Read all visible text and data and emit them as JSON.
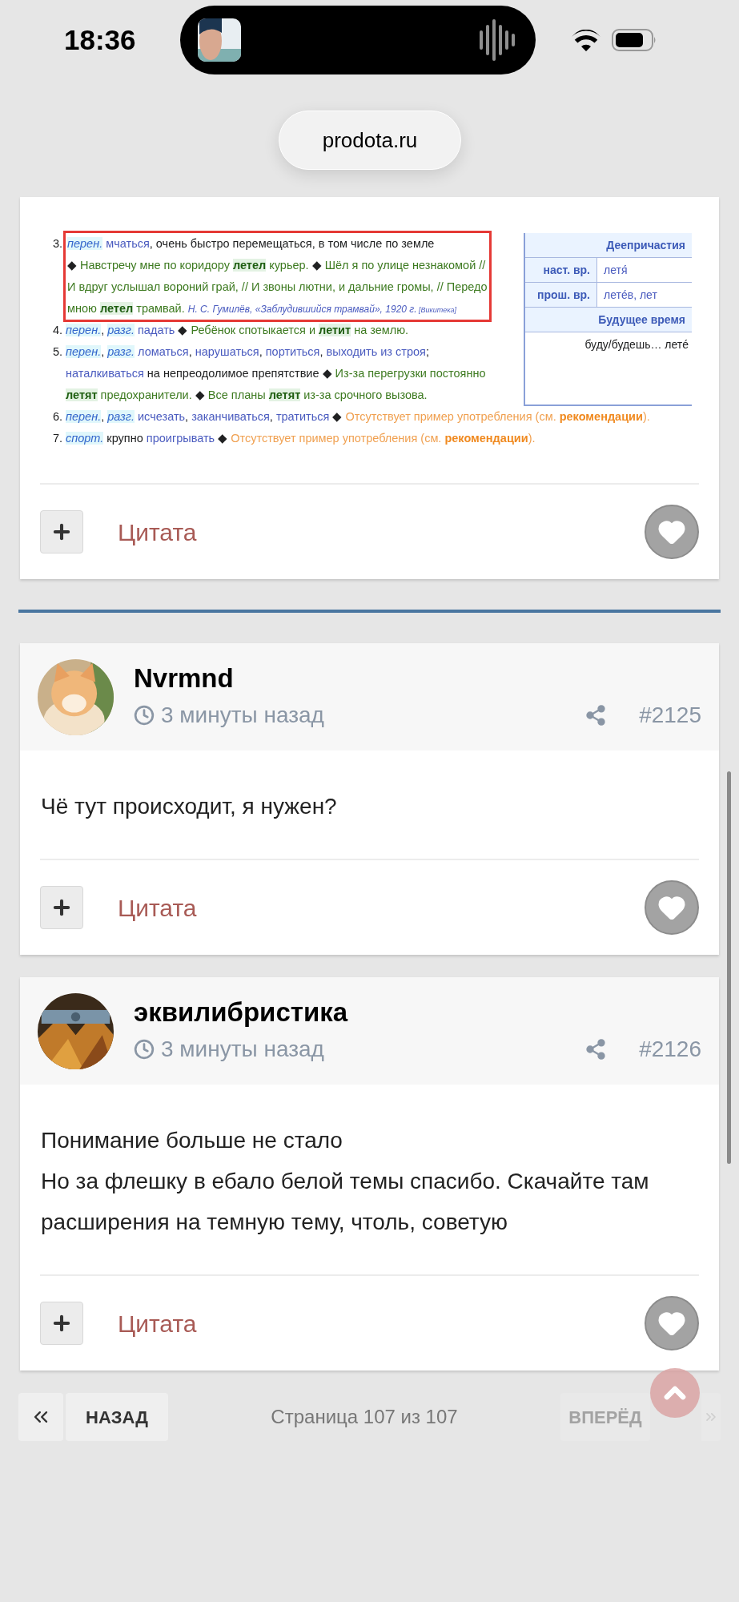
{
  "status_bar": {
    "time": "18:36"
  },
  "address_bar": {
    "url": "prodota.ru"
  },
  "excerpt": {
    "entries": [
      {
        "number": "3.",
        "boxed": true,
        "lines": [
          [
            {
              "kind": "tag",
              "text": "перен."
            },
            {
              "kind": "link",
              "text": " мчаться"
            },
            {
              "kind": "plain",
              "text": ", очень быстро перемещаться, в том числе по земле"
            }
          ],
          [
            {
              "kind": "mark",
              "text": "◆"
            },
            {
              "kind": "ex",
              "text": " Навстречу мне по коридору "
            },
            {
              "kind": "hit",
              "text": "летел"
            },
            {
              "kind": "ex",
              "text": " курьер. "
            },
            {
              "kind": "mark",
              "text": "◆"
            },
            {
              "kind": "ex",
              "text": " Шёл я по улице незнакомой //"
            }
          ],
          [
            {
              "kind": "ex",
              "text": "И вдруг услышал вороний грай, // И звоны лютни, и дальние громы, // Передо"
            }
          ],
          [
            {
              "kind": "ex",
              "text": "мною "
            },
            {
              "kind": "hit",
              "text": "летел"
            },
            {
              "kind": "ex",
              "text": " трамвай. "
            },
            {
              "kind": "src",
              "text": "Н. С. Гумилёв, «Заблудившийся трамвай», 1920 г."
            },
            {
              "kind": "ref",
              "text": " [Викитека]"
            }
          ]
        ]
      },
      {
        "number": "4.",
        "boxed": false,
        "lines": [
          [
            {
              "kind": "tag",
              "text": "перен."
            },
            {
              "kind": "plain",
              "text": ", "
            },
            {
              "kind": "tag",
              "text": "разг."
            },
            {
              "kind": "link",
              "text": " падать"
            },
            {
              "kind": "mark",
              "text": " ◆"
            },
            {
              "kind": "ex",
              "text": " Ребёнок спотыкается и "
            },
            {
              "kind": "hit",
              "text": "летит"
            },
            {
              "kind": "ex",
              "text": " на землю."
            }
          ]
        ]
      },
      {
        "number": "5.",
        "boxed": false,
        "lines": [
          [
            {
              "kind": "tag",
              "text": "перен."
            },
            {
              "kind": "plain",
              "text": ", "
            },
            {
              "kind": "tag",
              "text": "разг."
            },
            {
              "kind": "link",
              "text": " ломаться"
            },
            {
              "kind": "plain",
              "text": ", "
            },
            {
              "kind": "link",
              "text": "нарушаться"
            },
            {
              "kind": "plain",
              "text": ", "
            },
            {
              "kind": "link",
              "text": "портиться"
            },
            {
              "kind": "plain",
              "text": ", "
            },
            {
              "kind": "link",
              "text": "выходить из строя"
            },
            {
              "kind": "plain",
              "text": ";"
            }
          ],
          [
            {
              "kind": "link",
              "text": "наталкиваться"
            },
            {
              "kind": "plain",
              "text": " на непреодолимое препятствие "
            },
            {
              "kind": "mark",
              "text": "◆"
            },
            {
              "kind": "ex",
              "text": " Из-за перегрузки постоянно"
            }
          ],
          [
            {
              "kind": "hit",
              "text": "летят"
            },
            {
              "kind": "ex",
              "text": " предохранители. "
            },
            {
              "kind": "mark",
              "text": "◆"
            },
            {
              "kind": "ex",
              "text": " Все планы "
            },
            {
              "kind": "hit",
              "text": "летят"
            },
            {
              "kind": "ex",
              "text": " из-за срочного вызова."
            }
          ]
        ]
      },
      {
        "number": "6.",
        "boxed": false,
        "lines": [
          [
            {
              "kind": "tag",
              "text": "перен."
            },
            {
              "kind": "plain",
              "text": ", "
            },
            {
              "kind": "tag",
              "text": "разг."
            },
            {
              "kind": "link",
              "text": " исчезать"
            },
            {
              "kind": "plain",
              "text": ", "
            },
            {
              "kind": "link",
              "text": "заканчиваться"
            },
            {
              "kind": "plain",
              "text": ", "
            },
            {
              "kind": "link",
              "text": "тратиться"
            },
            {
              "kind": "mark",
              "text": " ◆"
            },
            {
              "kind": "miss",
              "text": " Отсутствует пример употребления (см. "
            },
            {
              "kind": "missb",
              "text": "рекомендации"
            },
            {
              "kind": "miss",
              "text": ")."
            }
          ]
        ]
      },
      {
        "number": "7.",
        "boxed": false,
        "lines": [
          [
            {
              "kind": "tag",
              "text": "спорт."
            },
            {
              "kind": "plain",
              "text": " крупно "
            },
            {
              "kind": "link",
              "text": "проигрывать"
            },
            {
              "kind": "mark",
              "text": " ◆"
            },
            {
              "kind": "miss",
              "text": " Отсутствует пример употребления (см. "
            },
            {
              "kind": "missb",
              "text": "рекомендации"
            },
            {
              "kind": "miss",
              "text": ")."
            }
          ]
        ]
      }
    ],
    "table": [
      {
        "kind": "header",
        "text": "Деепричастия"
      },
      {
        "kind": "row",
        "label": "наст. вр.",
        "value": "летя́"
      },
      {
        "kind": "row",
        "label": "прош. вр.",
        "value": "летéв, лет"
      },
      {
        "kind": "header",
        "text": "Будущее время"
      },
      {
        "kind": "full",
        "text": "буду/будешь… летé"
      }
    ]
  },
  "first_post_footer": {
    "quote": "Цитата"
  },
  "posts": [
    {
      "author": "Nvrmnd",
      "time": "3 минуты назад",
      "number": "#2125",
      "body": [
        "Чё тут происходит, я нужен?"
      ],
      "quote": "Цитата"
    },
    {
      "author": "эквилибристика",
      "time": "3 минуты назад",
      "number": "#2126",
      "body": [
        "Понимание больше не стало",
        "Но за флешку в ебало белой темы спасибо. Скачайте там расширения на темную тему, чтоль, советую"
      ],
      "quote": "Цитата"
    }
  ],
  "pagination": {
    "prev": {
      "label": "НАЗАД",
      "disabled": false
    },
    "info": "Страница 107 из 107",
    "next": {
      "label": "ВПЕРЁД",
      "disabled": true
    }
  }
}
